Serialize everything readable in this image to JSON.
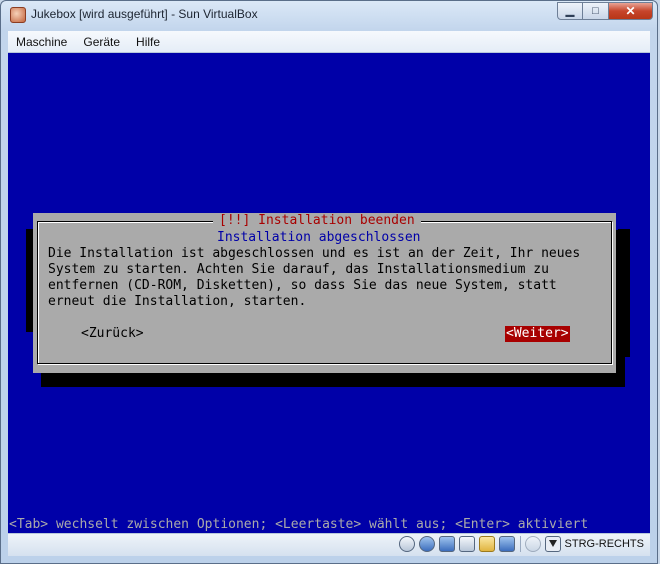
{
  "window": {
    "title": "Jukebox [wird ausgeführt] - Sun VirtualBox",
    "minimize_glyph": "▁",
    "maximize_glyph": "□",
    "close_glyph": "✕"
  },
  "menubar": {
    "items": [
      {
        "label": "Maschine"
      },
      {
        "label": "Geräte"
      },
      {
        "label": "Hilfe"
      }
    ]
  },
  "installer": {
    "dialog_title": "[!!] Installation beenden",
    "subtitle": "Installation abgeschlossen",
    "message_lines": [
      "Die Installation ist abgeschlossen und es ist an der Zeit, Ihr neues",
      "System zu starten. Achten Sie darauf, das Installationsmedium zu",
      "entfernen (CD-ROM, Disketten), so dass Sie das neue System, statt",
      "erneut die Installation, starten."
    ],
    "back_button": "<Zurück>",
    "next_button": "<Weiter>",
    "help_line": "<Tab> wechselt zwischen Optionen; <Leertaste> wählt aus; <Enter> aktiviert"
  },
  "statusbar": {
    "icons": [
      "hard-disk-icon",
      "cd-rom-icon",
      "usb-icon",
      "network-icon",
      "shared-folder-icon",
      "mouse-integration-icon",
      "host-key-icon"
    ],
    "host_key_label": "STRG-RECHTS"
  },
  "colors": {
    "vm_background": "#0000a8",
    "dialog_gray": "#aaaaaa",
    "title_red": "#a80000",
    "subtitle_blue": "#0000a8",
    "selected_button_bg": "#a80000"
  }
}
